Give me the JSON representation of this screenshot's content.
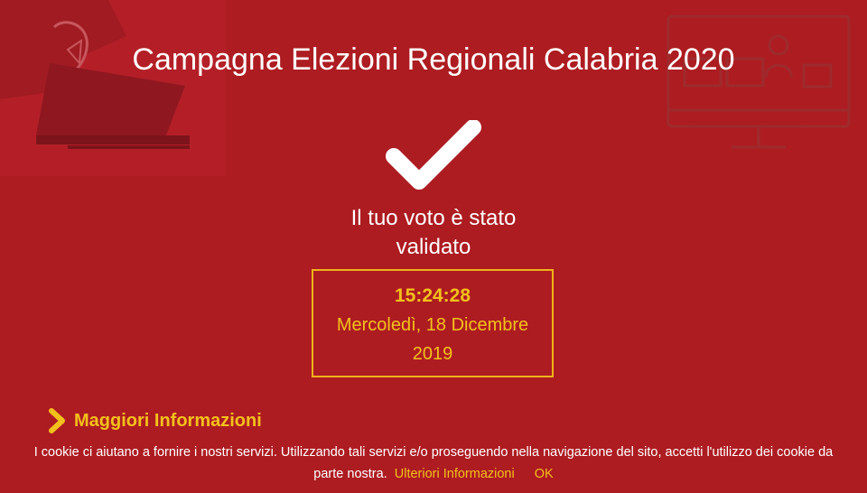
{
  "header": {
    "title": "Campagna Elezioni Regionali Calabria 2020"
  },
  "status": {
    "message_line1": "Il tuo voto è stato",
    "message_line2": "validato"
  },
  "timestamp": {
    "time": "15:24:28",
    "date_line1": "Mercoledì, 18 Dicembre",
    "date_line2": "2019"
  },
  "more_info": {
    "label": "Maggiori Informazioni"
  },
  "cookie_banner": {
    "text_line1": "I cookie ci aiutano a fornire i nostri servizi. Utilizzando tali servizi e/o proseguendo nella navigazione del sito, accetti l'utilizzo dei cookie da",
    "text_line2": "parte nostra.",
    "more_link": "Ulteriori Informazioni",
    "ok_link": "OK"
  },
  "colors": {
    "background": "#ad1c21",
    "accent": "#f4c01c",
    "text": "#ffffff"
  },
  "icons": {
    "check": "checkmark-icon",
    "chevron": "chevron-right-icon",
    "ballot": "ballot-box-icon",
    "monitor": "voting-monitor-icon"
  }
}
